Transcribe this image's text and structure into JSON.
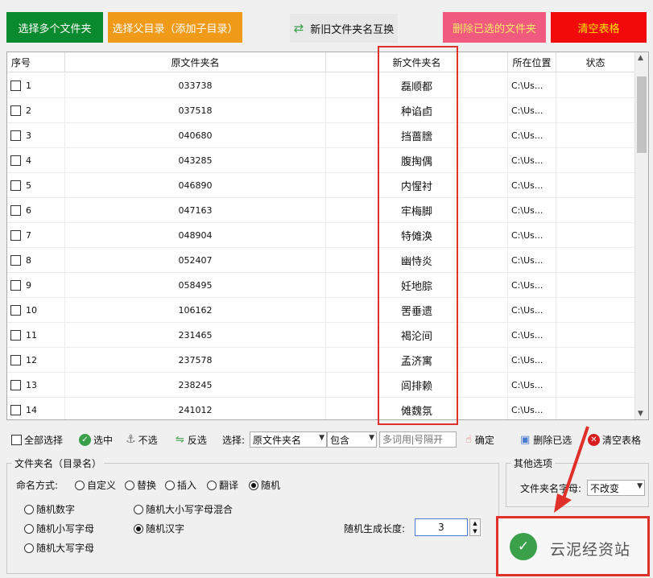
{
  "top_buttons": {
    "select_folders": "选择多个文件夹",
    "select_parent": "选择父目录（添加子目录）",
    "swap": "新旧文件夹名互换",
    "delete_selected": "删除已选的文件夹",
    "clear_table": "清空表格"
  },
  "table": {
    "headers": {
      "seq": "序号",
      "orig": "原文件夹名",
      "new": "新文件夹名",
      "path": "所在位置",
      "status": "状态"
    },
    "rows": [
      {
        "seq": "1",
        "orig": "033738",
        "new": "磊顺都",
        "path": "C:\\Us..."
      },
      {
        "seq": "2",
        "orig": "037518",
        "new": "种谄卣",
        "path": "C:\\Us..."
      },
      {
        "seq": "3",
        "orig": "040680",
        "new": "挡蔷膪",
        "path": "C:\\Us..."
      },
      {
        "seq": "4",
        "orig": "043285",
        "new": "腹掏偶",
        "path": "C:\\Us..."
      },
      {
        "seq": "5",
        "orig": "046890",
        "new": "内惺衬",
        "path": "C:\\Us..."
      },
      {
        "seq": "6",
        "orig": "047163",
        "new": "牢梅脚",
        "path": "C:\\Us..."
      },
      {
        "seq": "7",
        "orig": "048904",
        "new": "特傩涣",
        "path": "C:\\Us..."
      },
      {
        "seq": "8",
        "orig": "052407",
        "new": "幽恃炎",
        "path": "C:\\Us..."
      },
      {
        "seq": "9",
        "orig": "058495",
        "new": "妊地腙",
        "path": "C:\\Us..."
      },
      {
        "seq": "10",
        "orig": "106162",
        "new": "罟垂遗",
        "path": "C:\\Us..."
      },
      {
        "seq": "11",
        "orig": "231465",
        "new": "褐沦间",
        "path": "C:\\Us..."
      },
      {
        "seq": "12",
        "orig": "237578",
        "new": "孟济寓",
        "path": "C:\\Us..."
      },
      {
        "seq": "13",
        "orig": "238245",
        "new": "闾排赖",
        "path": "C:\\Us..."
      },
      {
        "seq": "14",
        "orig": "241012",
        "new": "傩魏氛",
        "path": "C:\\Us..."
      }
    ]
  },
  "toolbar": {
    "select_all": "全部选择",
    "select": "选中",
    "deselect": "不选",
    "invert": "反选",
    "choose_label": "选择:",
    "field_select": "原文件夹名",
    "match_select": "包含",
    "keyword_placeholder": "多词用|号隔开",
    "confirm": "确定",
    "delete_selected": "删除已选",
    "clear_table": "清空表格"
  },
  "naming": {
    "group_title": "文件夹名（目录名）",
    "mode_label": "命名方式:",
    "modes": [
      "自定义",
      "替换",
      "插入",
      "翻译",
      "随机"
    ],
    "selected_mode": "随机",
    "random_options": {
      "digits": "随机数字",
      "mixed_case": "随机大小写字母混合",
      "lower": "随机小写字母",
      "chinese": "随机汉字",
      "upper": "随机大写字母"
    },
    "selected_random": "随机汉字",
    "length_label": "随机生成长度:",
    "length_value": "3"
  },
  "other": {
    "group_title": "其他选项",
    "case_label": "文件夹名字母:",
    "case_value": "不改变"
  },
  "watermark": {
    "text": "云泥经资站"
  },
  "colors": {
    "green": "#0a8a2e",
    "orange": "#f09a1a",
    "pink": "#f05a7e",
    "red": "#f00a0a",
    "annotation": "#e0302a"
  }
}
